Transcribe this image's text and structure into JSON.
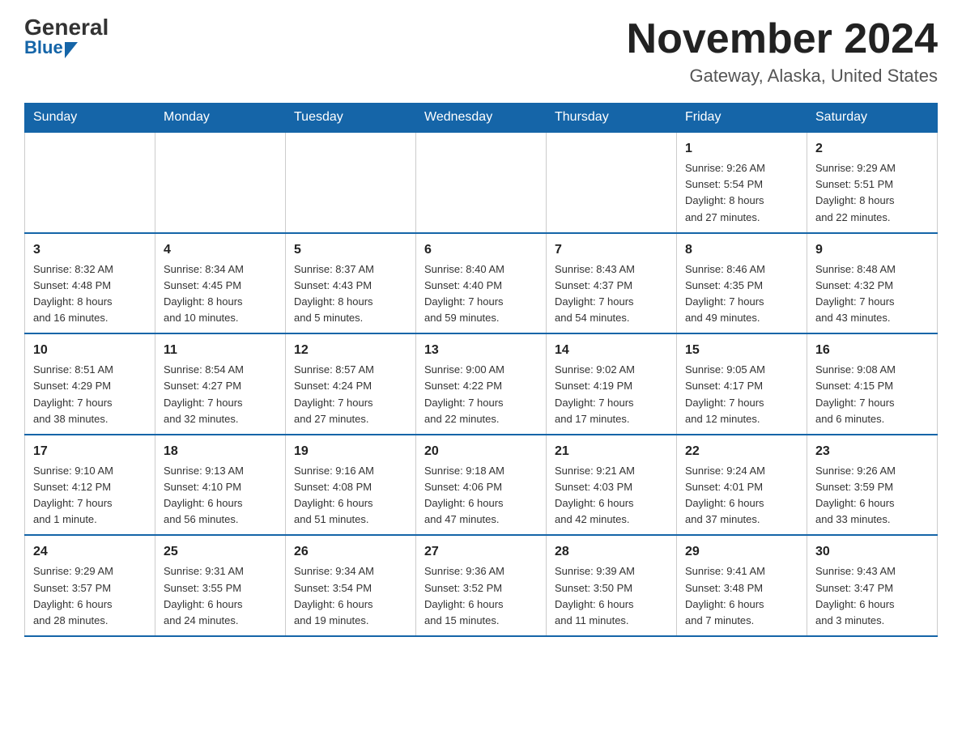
{
  "logo": {
    "general": "General",
    "blue": "Blue"
  },
  "title": "November 2024",
  "location": "Gateway, Alaska, United States",
  "weekdays": [
    "Sunday",
    "Monday",
    "Tuesday",
    "Wednesday",
    "Thursday",
    "Friday",
    "Saturday"
  ],
  "weeks": [
    [
      {
        "day": "",
        "info": ""
      },
      {
        "day": "",
        "info": ""
      },
      {
        "day": "",
        "info": ""
      },
      {
        "day": "",
        "info": ""
      },
      {
        "day": "",
        "info": ""
      },
      {
        "day": "1",
        "info": "Sunrise: 9:26 AM\nSunset: 5:54 PM\nDaylight: 8 hours\nand 27 minutes."
      },
      {
        "day": "2",
        "info": "Sunrise: 9:29 AM\nSunset: 5:51 PM\nDaylight: 8 hours\nand 22 minutes."
      }
    ],
    [
      {
        "day": "3",
        "info": "Sunrise: 8:32 AM\nSunset: 4:48 PM\nDaylight: 8 hours\nand 16 minutes."
      },
      {
        "day": "4",
        "info": "Sunrise: 8:34 AM\nSunset: 4:45 PM\nDaylight: 8 hours\nand 10 minutes."
      },
      {
        "day": "5",
        "info": "Sunrise: 8:37 AM\nSunset: 4:43 PM\nDaylight: 8 hours\nand 5 minutes."
      },
      {
        "day": "6",
        "info": "Sunrise: 8:40 AM\nSunset: 4:40 PM\nDaylight: 7 hours\nand 59 minutes."
      },
      {
        "day": "7",
        "info": "Sunrise: 8:43 AM\nSunset: 4:37 PM\nDaylight: 7 hours\nand 54 minutes."
      },
      {
        "day": "8",
        "info": "Sunrise: 8:46 AM\nSunset: 4:35 PM\nDaylight: 7 hours\nand 49 minutes."
      },
      {
        "day": "9",
        "info": "Sunrise: 8:48 AM\nSunset: 4:32 PM\nDaylight: 7 hours\nand 43 minutes."
      }
    ],
    [
      {
        "day": "10",
        "info": "Sunrise: 8:51 AM\nSunset: 4:29 PM\nDaylight: 7 hours\nand 38 minutes."
      },
      {
        "day": "11",
        "info": "Sunrise: 8:54 AM\nSunset: 4:27 PM\nDaylight: 7 hours\nand 32 minutes."
      },
      {
        "day": "12",
        "info": "Sunrise: 8:57 AM\nSunset: 4:24 PM\nDaylight: 7 hours\nand 27 minutes."
      },
      {
        "day": "13",
        "info": "Sunrise: 9:00 AM\nSunset: 4:22 PM\nDaylight: 7 hours\nand 22 minutes."
      },
      {
        "day": "14",
        "info": "Sunrise: 9:02 AM\nSunset: 4:19 PM\nDaylight: 7 hours\nand 17 minutes."
      },
      {
        "day": "15",
        "info": "Sunrise: 9:05 AM\nSunset: 4:17 PM\nDaylight: 7 hours\nand 12 minutes."
      },
      {
        "day": "16",
        "info": "Sunrise: 9:08 AM\nSunset: 4:15 PM\nDaylight: 7 hours\nand 6 minutes."
      }
    ],
    [
      {
        "day": "17",
        "info": "Sunrise: 9:10 AM\nSunset: 4:12 PM\nDaylight: 7 hours\nand 1 minute."
      },
      {
        "day": "18",
        "info": "Sunrise: 9:13 AM\nSunset: 4:10 PM\nDaylight: 6 hours\nand 56 minutes."
      },
      {
        "day": "19",
        "info": "Sunrise: 9:16 AM\nSunset: 4:08 PM\nDaylight: 6 hours\nand 51 minutes."
      },
      {
        "day": "20",
        "info": "Sunrise: 9:18 AM\nSunset: 4:06 PM\nDaylight: 6 hours\nand 47 minutes."
      },
      {
        "day": "21",
        "info": "Sunrise: 9:21 AM\nSunset: 4:03 PM\nDaylight: 6 hours\nand 42 minutes."
      },
      {
        "day": "22",
        "info": "Sunrise: 9:24 AM\nSunset: 4:01 PM\nDaylight: 6 hours\nand 37 minutes."
      },
      {
        "day": "23",
        "info": "Sunrise: 9:26 AM\nSunset: 3:59 PM\nDaylight: 6 hours\nand 33 minutes."
      }
    ],
    [
      {
        "day": "24",
        "info": "Sunrise: 9:29 AM\nSunset: 3:57 PM\nDaylight: 6 hours\nand 28 minutes."
      },
      {
        "day": "25",
        "info": "Sunrise: 9:31 AM\nSunset: 3:55 PM\nDaylight: 6 hours\nand 24 minutes."
      },
      {
        "day": "26",
        "info": "Sunrise: 9:34 AM\nSunset: 3:54 PM\nDaylight: 6 hours\nand 19 minutes."
      },
      {
        "day": "27",
        "info": "Sunrise: 9:36 AM\nSunset: 3:52 PM\nDaylight: 6 hours\nand 15 minutes."
      },
      {
        "day": "28",
        "info": "Sunrise: 9:39 AM\nSunset: 3:50 PM\nDaylight: 6 hours\nand 11 minutes."
      },
      {
        "day": "29",
        "info": "Sunrise: 9:41 AM\nSunset: 3:48 PM\nDaylight: 6 hours\nand 7 minutes."
      },
      {
        "day": "30",
        "info": "Sunrise: 9:43 AM\nSunset: 3:47 PM\nDaylight: 6 hours\nand 3 minutes."
      }
    ]
  ]
}
